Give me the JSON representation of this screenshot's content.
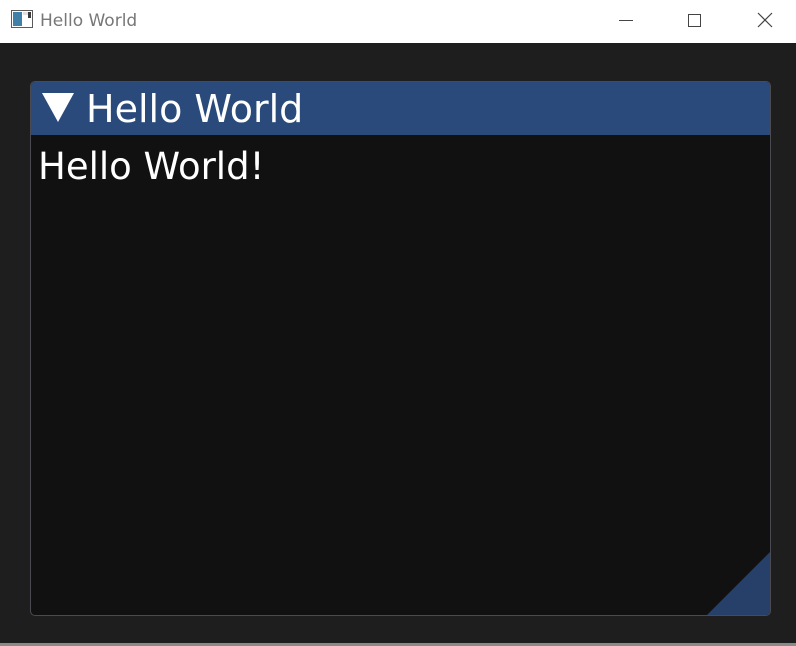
{
  "window": {
    "title": "Hello World",
    "icon": "app-window-icon",
    "controls": [
      "minimize-icon",
      "maximize-icon",
      "close-icon"
    ]
  },
  "imgui_window": {
    "title": "Hello World",
    "collapse_icon": "collapse-arrow-down-icon",
    "text": "Hello World!",
    "resize_grip_icon": "resize-grip-icon"
  },
  "colors": {
    "titlebar_bg": "#ffffff",
    "client_bg": "#1e1e1e",
    "imgui_title_bg": "#294a7a",
    "imgui_body_bg": "#111111",
    "imgui_text": "#ffffff",
    "resize_grip": "#26406a"
  }
}
